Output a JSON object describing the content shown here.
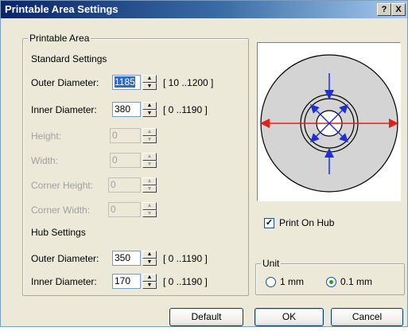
{
  "window": {
    "title": "Printable Area Settings",
    "help_label": "?",
    "close_label": "X"
  },
  "printable_area": {
    "legend": "Printable Area",
    "standard_heading": "Standard Settings",
    "rows": [
      {
        "label": "Outer Diameter:",
        "value": "1185",
        "range": "[  10  ..1200  ]",
        "enabled": true
      },
      {
        "label": "Inner Diameter:",
        "value": "380",
        "range": "[   0  ..1190  ]",
        "enabled": true
      },
      {
        "label": "Height:",
        "value": "0",
        "range": "",
        "enabled": false
      },
      {
        "label": "Width:",
        "value": "0",
        "range": "",
        "enabled": false
      },
      {
        "label": "Corner Height:",
        "value": "0",
        "range": "",
        "enabled": false
      },
      {
        "label": "Corner Width:",
        "value": "0",
        "range": "",
        "enabled": false
      }
    ],
    "hub_heading": "Hub Settings",
    "hub_rows": [
      {
        "label": "Outer Diameter:",
        "value": "350",
        "range": "[   0  ..1190  ]",
        "enabled": true
      },
      {
        "label": "Inner Diameter:",
        "value": "170",
        "range": "[   0  ..1190  ]",
        "enabled": true
      }
    ]
  },
  "print_on_hub": {
    "label": "Print On Hub",
    "checked": true
  },
  "unit": {
    "legend": "Unit",
    "options": [
      {
        "label": "1 mm",
        "selected": false
      },
      {
        "label": "0.1 mm",
        "selected": true
      }
    ]
  },
  "buttons": {
    "default": "Default",
    "ok": "OK",
    "cancel": "Cancel"
  },
  "colors": {
    "horizontal_arrow": "#e0201c",
    "vertical_arrow": "#1f2fd6",
    "diagonal_arrow": "#1f2fd6"
  }
}
